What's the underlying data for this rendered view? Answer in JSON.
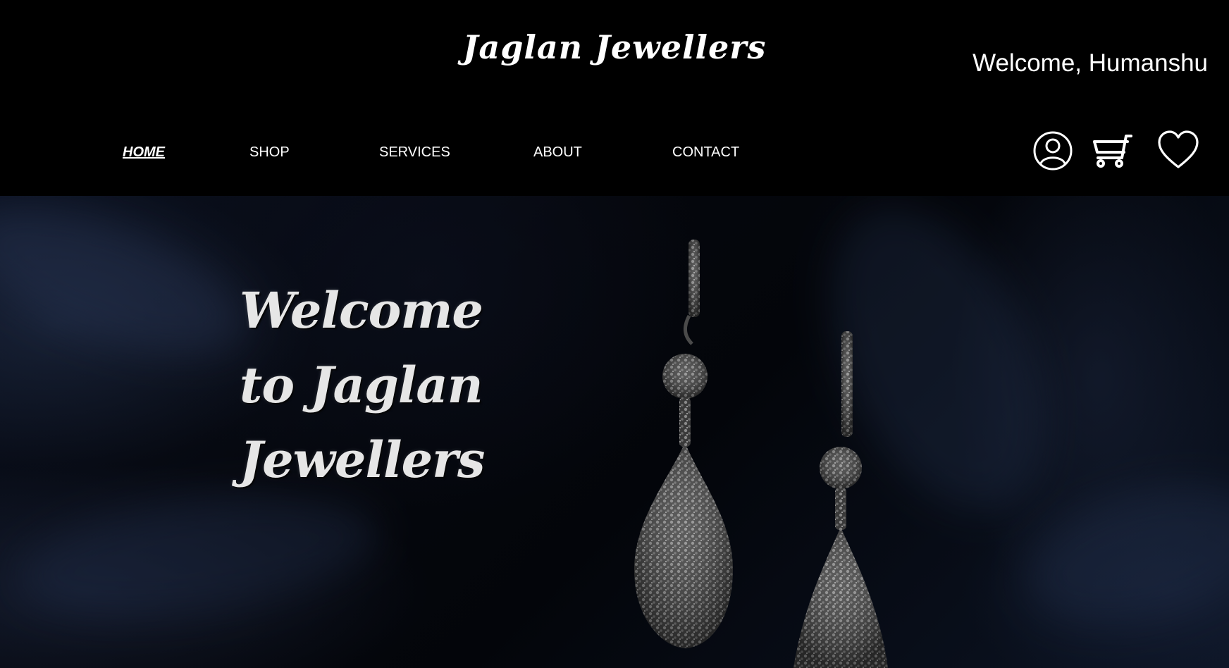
{
  "header": {
    "brand": "Jaglan Jewellers",
    "welcome_text": "Welcome, Humanshu"
  },
  "nav": {
    "items": [
      {
        "label": "HOME",
        "active": true
      },
      {
        "label": "SHOP",
        "active": false
      },
      {
        "label": "SERVICES",
        "active": false
      },
      {
        "label": "ABOUT",
        "active": false
      },
      {
        "label": "CONTACT",
        "active": false
      }
    ]
  },
  "icons": [
    "user-icon",
    "cart-icon",
    "heart-icon"
  ],
  "hero": {
    "title_lines": [
      "Welcome",
      "to Jaglan",
      "Jewellers"
    ]
  },
  "colors": {
    "background": "#000000",
    "text": "#ffffff",
    "hero_text": "#e6e6e6"
  }
}
